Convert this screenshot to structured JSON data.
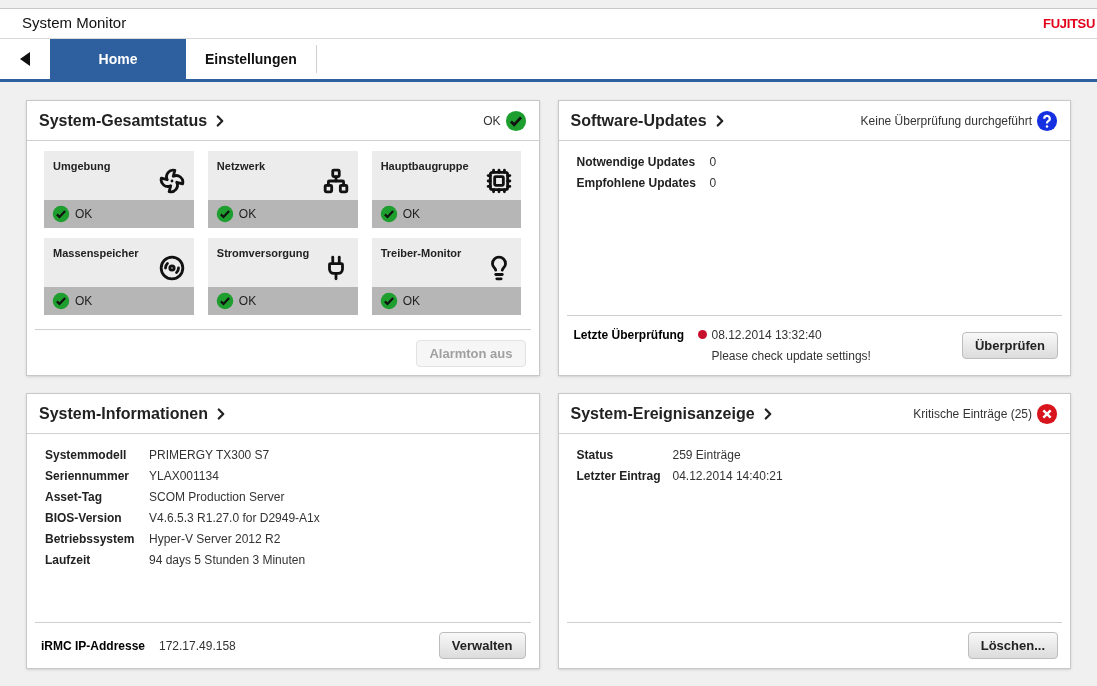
{
  "window": {
    "title": "System Monitor",
    "logo": "FUJITSU"
  },
  "tabs": [
    {
      "label": "Home",
      "selected": true
    },
    {
      "label": "Einstellungen",
      "selected": false
    }
  ],
  "overall_status": {
    "title": "System-Gesamtstatus",
    "status_text": "OK",
    "kind": "ok",
    "tiles": [
      {
        "label": "Umgebung",
        "kind": "ok",
        "status_text": "OK"
      },
      {
        "label": "Netzwerk",
        "kind": "ok",
        "status_text": "OK"
      },
      {
        "label": "Hauptbaugruppe",
        "kind": "ok",
        "status_text": "OK"
      },
      {
        "label": "Massenspeicher",
        "kind": "ok",
        "status_text": "OK"
      },
      {
        "label": "Stromversorgung",
        "kind": "ok",
        "status_text": "OK"
      },
      {
        "label": "Treiber-Monitor",
        "kind": "ok",
        "status_text": "OK"
      }
    ],
    "button": {
      "label": "Alarmton aus",
      "disabled": true
    }
  },
  "software_updates": {
    "title": "Software-Updates",
    "status_text": "Keine Überprüfung durchgeführt",
    "kind": "unknown",
    "rows": [
      {
        "label": "Notwendige Updates",
        "value": "0"
      },
      {
        "label": "Empfohlene Updates",
        "value": "0"
      }
    ],
    "last_check": {
      "label": "Letzte Überprüfung",
      "color": "#c8102e",
      "value": "08.12.2014 13:32:40",
      "note": "Please check update settings!"
    },
    "button": {
      "label": "Überprüfen",
      "disabled": false
    }
  },
  "system_info": {
    "title": "System-Informationen",
    "rows": [
      {
        "label": "Systemmodell",
        "value": "PRIMERGY TX300 S7"
      },
      {
        "label": "Seriennummer",
        "value": "YLAX001134"
      },
      {
        "label": "Asset-Tag",
        "value": "SCOM Production Server"
      },
      {
        "label": "BIOS-Version",
        "value": "V4.6.5.3 R1.27.0 for D2949-A1x"
      },
      {
        "label": "Betriebssystem",
        "value": "Hyper-V Server 2012 R2"
      },
      {
        "label": "Laufzeit",
        "value": "94 days 5 Stunden 3 Minuten"
      }
    ],
    "footer": {
      "label": "iRMC IP-Addresse",
      "value": "172.17.49.158"
    },
    "button": {
      "label": "Verwalten",
      "disabled": false
    }
  },
  "event_log": {
    "title": "System-Ereignisanzeige",
    "status_text": "Kritische Einträge (25)",
    "kind": "error",
    "rows": [
      {
        "label": "Status",
        "value": "259 Einträge"
      },
      {
        "label": "Letzter Eintrag",
        "value": "04.12.2014 14:40:21"
      }
    ],
    "button": {
      "label": "Löschen...",
      "disabled": false
    }
  }
}
